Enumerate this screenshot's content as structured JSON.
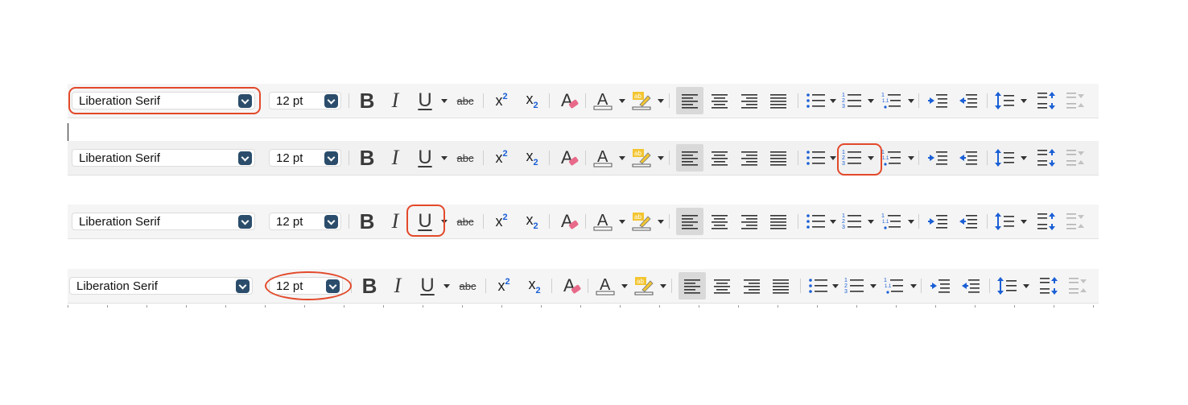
{
  "toolbars": [
    {
      "font_name": "Liberation Serif",
      "font_size": "12 pt",
      "highlighted": "font-name-box"
    },
    {
      "font_name": "Liberation Serif",
      "font_size": "12 pt",
      "highlighted": "numbered-list-button"
    },
    {
      "font_name": "Liberation Serif",
      "font_size": "12 pt",
      "highlighted": "underline-button"
    },
    {
      "font_name": "Liberation Serif",
      "font_size": "12 pt",
      "highlighted": "font-size-box"
    }
  ],
  "buttons": {
    "bold": "B",
    "italic": "I",
    "underline": "U",
    "strikethrough": "abc",
    "superscript_base": "x",
    "superscript_exp": "2",
    "subscript_base": "x",
    "subscript_exp": "2"
  },
  "icons": [
    "clear-formatting-icon",
    "font-color-icon",
    "highlight-color-icon",
    "align-left-icon",
    "align-center-icon",
    "align-right-icon",
    "justify-icon",
    "bullet-list-icon",
    "numbered-list-icon",
    "outline-list-icon",
    "increase-indent-icon",
    "decrease-indent-icon",
    "line-spacing-icon",
    "increase-paragraph-spacing-icon",
    "decrease-paragraph-spacing-icon"
  ],
  "colors": {
    "highlight_ring": "#e3492a",
    "dropdown_button": "#2b4d6b",
    "accent_blue": "#1a5fd6",
    "highlighter_yellow": "#f3c531"
  }
}
